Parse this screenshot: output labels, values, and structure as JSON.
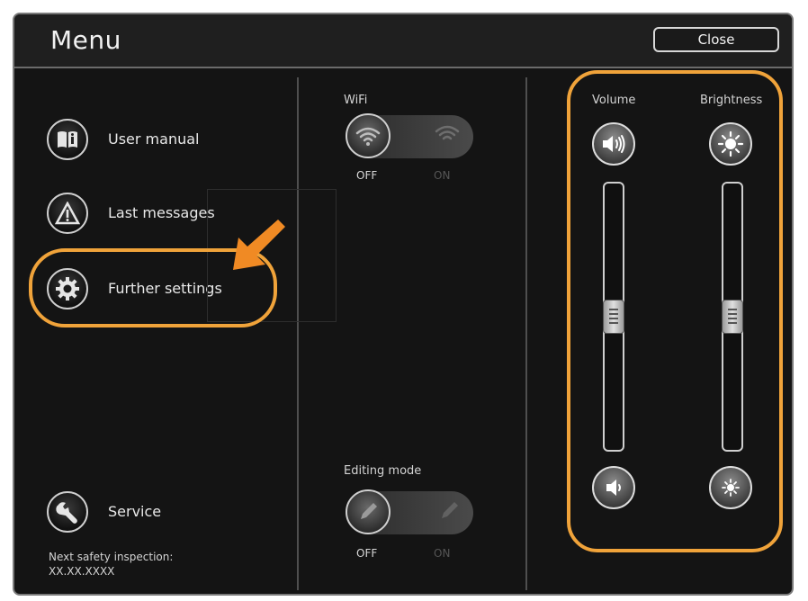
{
  "window": {
    "title": "Menu",
    "close_label": "Close"
  },
  "left_menu": {
    "items": [
      {
        "label": "User manual",
        "icon": "book-icon"
      },
      {
        "label": "Last messages",
        "icon": "warning-icon"
      },
      {
        "label": "Further settings",
        "icon": "gear-icon",
        "highlighted": true
      }
    ],
    "service": {
      "label": "Service",
      "icon": "wrench-icon"
    },
    "inspection_label": "Next safety inspection:",
    "inspection_date": "XX.XX.XXXX"
  },
  "middle": {
    "wifi": {
      "label": "WiFi",
      "off": "OFF",
      "on": "ON",
      "state": "OFF",
      "icon": "wifi-icon"
    },
    "editing": {
      "label": "Editing mode",
      "off": "OFF",
      "on": "ON",
      "state": "OFF",
      "icon": "pencil-icon"
    }
  },
  "right": {
    "volume": {
      "label": "Volume",
      "up_icon": "volume-up-icon",
      "down_icon": "volume-down-icon",
      "level": 0.5
    },
    "brightness": {
      "label": "Brightness",
      "up_icon": "brightness-up-icon",
      "down_icon": "brightness-down-icon",
      "level": 0.5
    }
  },
  "annotation": {
    "highlight_color": "#f0a33a",
    "arrow_color": "#f08a24"
  }
}
